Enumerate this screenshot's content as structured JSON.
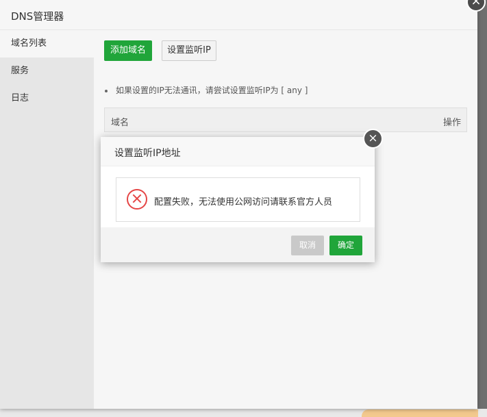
{
  "window": {
    "title": "DNS管理器",
    "close_icon": "×"
  },
  "sidebar": {
    "items": [
      {
        "label": "域名列表",
        "active": true
      },
      {
        "label": "服务",
        "active": false
      },
      {
        "label": "日志",
        "active": false
      }
    ]
  },
  "main": {
    "add_button": "添加域名",
    "set_listen_button": "设置监听IP",
    "tip": "如果设置的IP无法通讯，请尝试设置监听IP为 [ any ]",
    "table": {
      "columns": [
        "域名",
        "操作"
      ]
    }
  },
  "dialog": {
    "title": "设置监听IP地址",
    "close_icon": "×",
    "message": "配置失败，无法使用公网访问请联系官方人员",
    "cancel_label": "取消",
    "ok_label": "确定"
  },
  "colors": {
    "accent": "#20a53a",
    "error": "#e54545"
  }
}
